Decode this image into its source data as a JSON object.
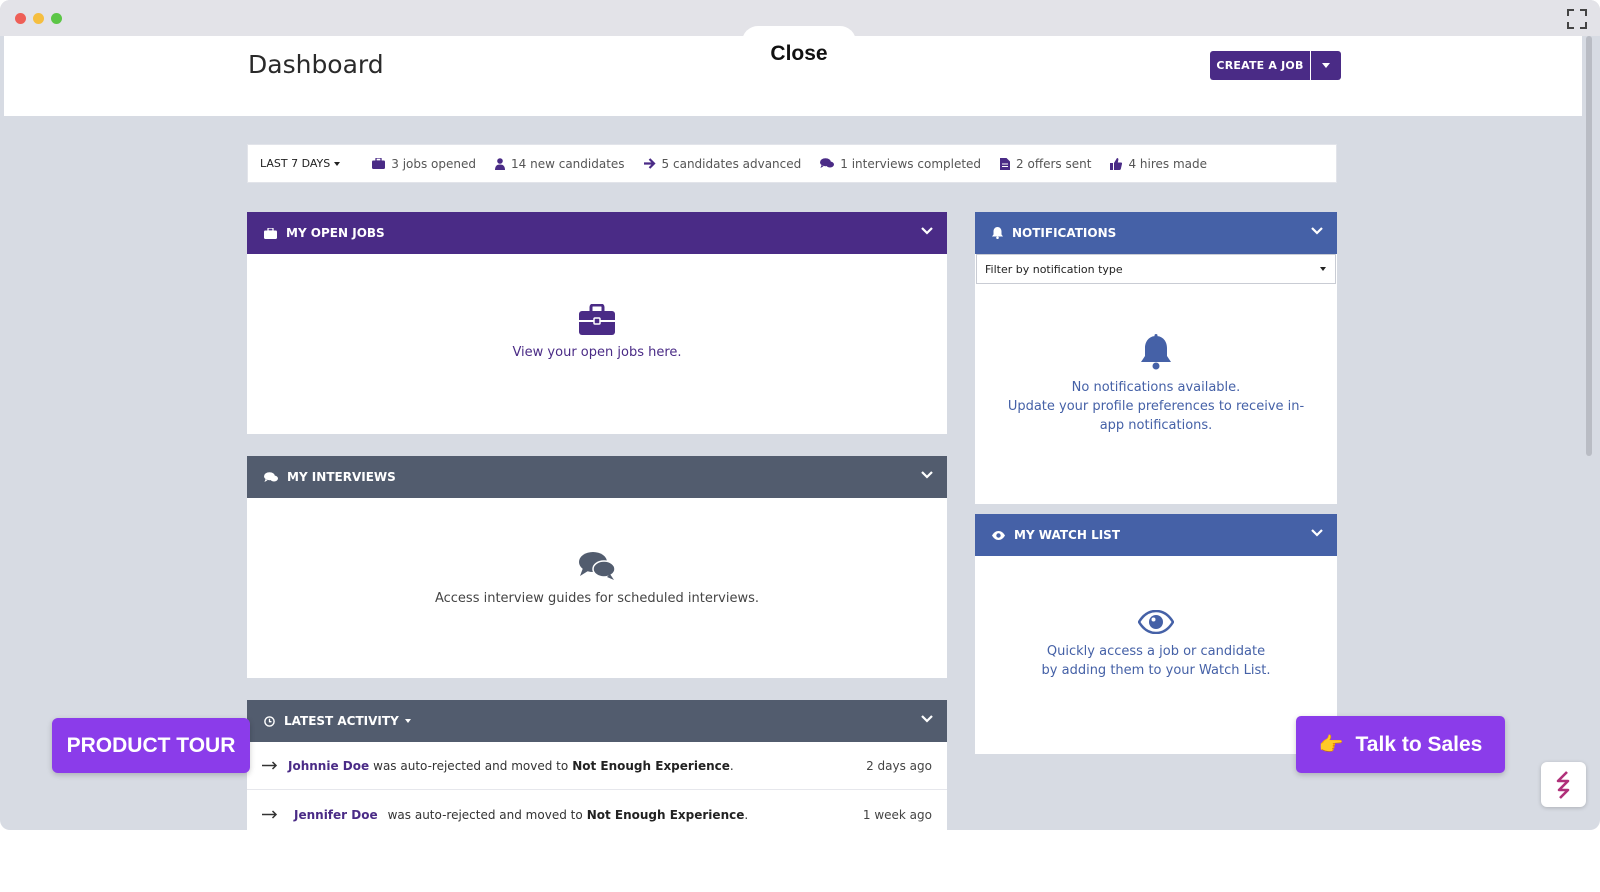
{
  "overlay": {
    "close_label": "Close"
  },
  "header": {
    "title": "Dashboard",
    "create_job_label": "CREATE A JOB"
  },
  "stats": {
    "range_label": "LAST 7 DAYS",
    "items": [
      {
        "icon": "briefcase-icon",
        "text": "3 jobs opened"
      },
      {
        "icon": "user-icon",
        "text": "14 new candidates"
      },
      {
        "icon": "arrow-right-icon",
        "text": "5 candidates advanced"
      },
      {
        "icon": "comments-icon",
        "text": "1 interviews completed"
      },
      {
        "icon": "document-icon",
        "text": "2 offers sent"
      },
      {
        "icon": "thumbs-up-icon",
        "text": "4 hires made"
      }
    ]
  },
  "open_jobs": {
    "title": "MY OPEN JOBS",
    "empty_text": "View your open jobs here.",
    "color": "#4a2b86"
  },
  "interviews": {
    "title": "MY INTERVIEWS",
    "empty_text": "Access interview guides for scheduled interviews."
  },
  "activity": {
    "title": "LATEST ACTIVITY",
    "rows": [
      {
        "name": "Johnnie Doe",
        "action": "was auto-rejected and moved to",
        "stage": "Not Enough Experience",
        "time": "2 days ago"
      },
      {
        "name": "Jennifer Doe",
        "action": "was auto-rejected and moved to",
        "stage": "Not Enough Experience",
        "time": "1 week ago"
      }
    ]
  },
  "notifications": {
    "title": "NOTIFICATIONS",
    "filter_label": "Filter by notification type",
    "empty_line1": "No notifications available.",
    "empty_line2": "Update your profile preferences to receive in-app notifications.",
    "color": "#4561a7"
  },
  "watch_list": {
    "title": "MY WATCH LIST",
    "empty_line1": "Quickly access a job or candidate",
    "empty_line2": "by adding them to your Watch List."
  },
  "floating": {
    "product_tour_label": "PRODUCT TOUR",
    "talk_sales_label": "Talk to Sales",
    "talk_sales_emoji": "👉",
    "accent": "#8b3cea"
  }
}
